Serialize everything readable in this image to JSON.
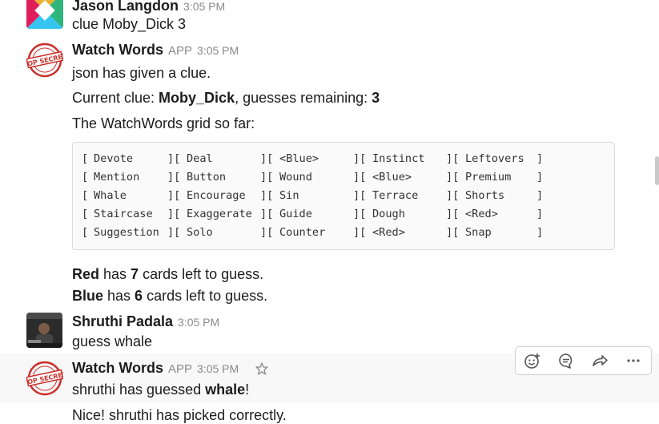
{
  "messages": [
    {
      "sender": "Jason Langdon",
      "time": "3:05 PM",
      "text": "clue Moby_Dick 3"
    },
    {
      "sender": "Watch Words",
      "badge": "APP",
      "time": "3:05 PM",
      "line1": "json has given a clue.",
      "clue_prefix": "Current clue: ",
      "clue_word": "Moby_Dick",
      "clue_mid": ", guesses remaining: ",
      "clue_count": "3",
      "grid_intro": "The WatchWords grid so far:",
      "red_team": "Red",
      "red_mid": " has ",
      "red_count": "7",
      "red_suffix": " cards left to guess.",
      "blue_team": "Blue",
      "blue_mid": " has ",
      "blue_count": "6",
      "blue_suffix": " cards left to guess."
    },
    {
      "sender": "Shruthi Padala",
      "time": "3:05 PM",
      "text": "guess whale"
    },
    {
      "sender": "Watch Words",
      "badge": "APP",
      "time": "3:05 PM",
      "guess_prefix": "shruthi has guessed ",
      "guess_word": "whale",
      "guess_suffix": "!",
      "result": "Nice! shruthi has picked correctly."
    }
  ],
  "grid": [
    [
      "Devote",
      "Deal",
      "<Blue>",
      "Instinct",
      "Leftovers"
    ],
    [
      "Mention",
      "Button",
      "Wound",
      "<Blue>",
      "Premium"
    ],
    [
      "Whale",
      "Encourage",
      "Sin",
      "Terrace",
      "Shorts"
    ],
    [
      "Staircase",
      "Exaggerate",
      "Guide",
      "Dough",
      "<Red>"
    ],
    [
      "Suggestion",
      "Solo",
      "Counter",
      "<Red>",
      "Snap"
    ]
  ],
  "toolbar": {
    "icons": [
      "add-reaction-icon",
      "reply-thread-icon",
      "share-icon",
      "more-icon"
    ]
  },
  "avatar_seal_text": "TOP SECRET",
  "colors": {
    "timestamp": "#8a8a8a",
    "hover_background": "#f8f8f8"
  }
}
